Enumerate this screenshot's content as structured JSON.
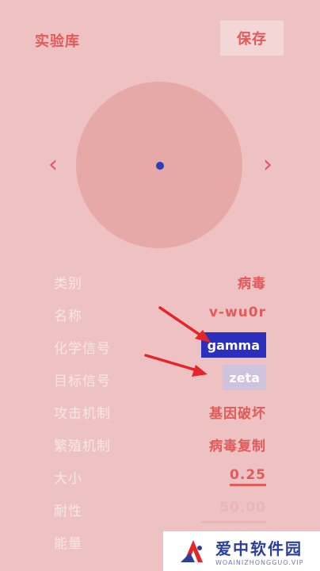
{
  "header": {
    "title": "实验库",
    "save_label": "保存"
  },
  "viewer": {
    "prev": "‹",
    "next": "›"
  },
  "props": [
    {
      "label": "类别",
      "value": "病毒"
    },
    {
      "label": "名称",
      "value": "v-wu0r"
    },
    {
      "label": "化学信号",
      "value": "gamma"
    },
    {
      "label": "目标信号",
      "value": "zeta"
    },
    {
      "label": "攻击机制",
      "value": "基因破坏"
    },
    {
      "label": "繁殖机制",
      "value": "病毒复制"
    },
    {
      "label": "大小",
      "value": "0.25"
    },
    {
      "label": "耐性",
      "value": "50.00"
    },
    {
      "label": "能量",
      "value": ""
    }
  ],
  "watermark": {
    "title": "爱中软件园",
    "subtitle": "WOAINIZHONGGUO.VIP"
  },
  "colors": {
    "accent": "#e25a5a",
    "background": "#eec2c3",
    "gamma": "#2c2fbd",
    "zeta": "#cfc2dd"
  }
}
